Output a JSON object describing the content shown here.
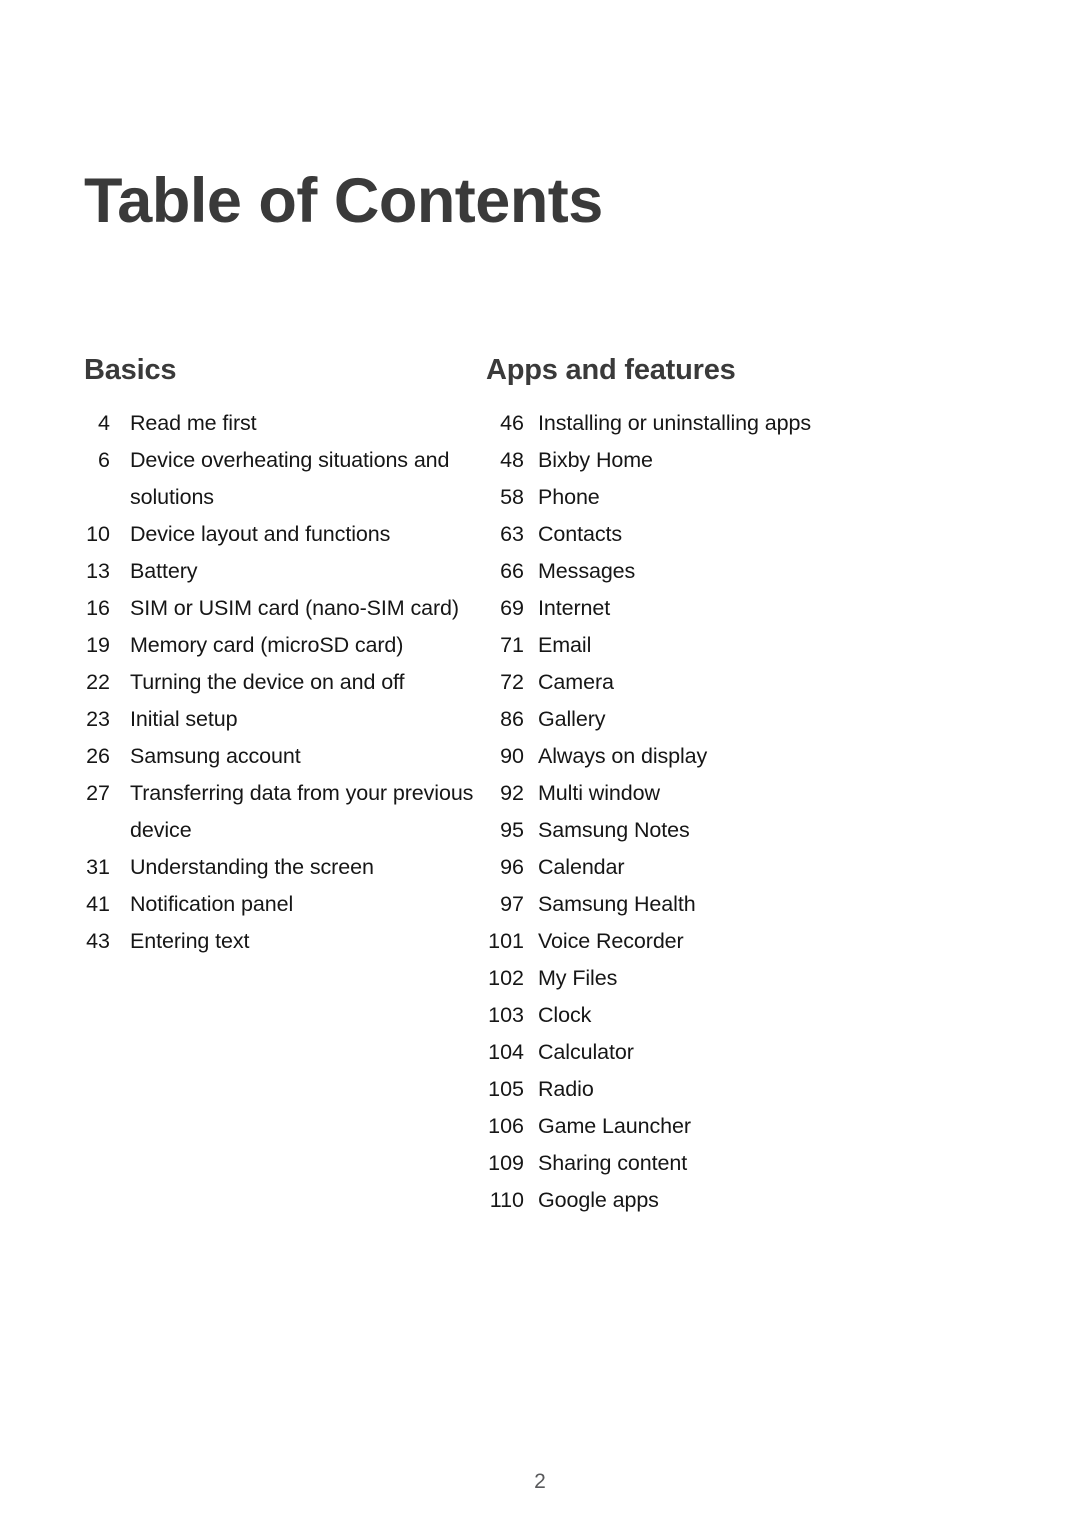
{
  "document": {
    "title": "Table of Contents",
    "footer_page_number": "2"
  },
  "colors": {
    "title": "#3a3a3a",
    "heading": "#3a3a3a",
    "body": "#161616",
    "footer": "#58595b",
    "background": "#ffffff"
  },
  "columns": [
    {
      "heading": "Basics",
      "entries": [
        {
          "page": "4",
          "title": "Read me first"
        },
        {
          "page": "6",
          "title": "Device overheating situations and solutions"
        },
        {
          "page": "10",
          "title": "Device layout and functions"
        },
        {
          "page": "13",
          "title": "Battery"
        },
        {
          "page": "16",
          "title": "SIM or USIM card (nano-SIM card)"
        },
        {
          "page": "19",
          "title": "Memory card (microSD card)"
        },
        {
          "page": "22",
          "title": "Turning the device on and off"
        },
        {
          "page": "23",
          "title": "Initial setup"
        },
        {
          "page": "26",
          "title": "Samsung account"
        },
        {
          "page": "27",
          "title": "Transferring data from your previous device"
        },
        {
          "page": "31",
          "title": "Understanding the screen"
        },
        {
          "page": "41",
          "title": "Notification panel"
        },
        {
          "page": "43",
          "title": "Entering text"
        }
      ]
    },
    {
      "heading": "Apps and features",
      "entries": [
        {
          "page": "46",
          "title": "Installing or uninstalling apps"
        },
        {
          "page": "48",
          "title": "Bixby Home"
        },
        {
          "page": "58",
          "title": "Phone"
        },
        {
          "page": "63",
          "title": "Contacts"
        },
        {
          "page": "66",
          "title": "Messages"
        },
        {
          "page": "69",
          "title": "Internet"
        },
        {
          "page": "71",
          "title": "Email"
        },
        {
          "page": "72",
          "title": "Camera"
        },
        {
          "page": "86",
          "title": "Gallery"
        },
        {
          "page": "90",
          "title": "Always on display"
        },
        {
          "page": "92",
          "title": "Multi window"
        },
        {
          "page": "95",
          "title": "Samsung Notes"
        },
        {
          "page": "96",
          "title": "Calendar"
        },
        {
          "page": "97",
          "title": "Samsung Health"
        },
        {
          "page": "101",
          "title": "Voice Recorder"
        },
        {
          "page": "102",
          "title": "My Files"
        },
        {
          "page": "103",
          "title": "Clock"
        },
        {
          "page": "104",
          "title": "Calculator"
        },
        {
          "page": "105",
          "title": "Radio"
        },
        {
          "page": "106",
          "title": "Game Launcher"
        },
        {
          "page": "109",
          "title": "Sharing content"
        },
        {
          "page": "110",
          "title": "Google apps"
        }
      ]
    }
  ]
}
